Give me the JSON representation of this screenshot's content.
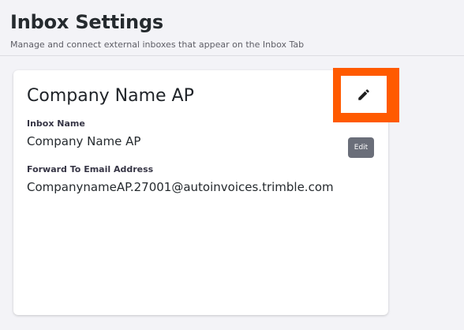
{
  "header": {
    "title": "Inbox Settings",
    "subtitle": "Manage and connect external inboxes that appear on the Inbox Tab"
  },
  "card": {
    "title": "Company Name AP",
    "inbox_name_label": "Inbox Name",
    "inbox_name_value": "Company Name AP",
    "forward_label": "Forward To Email Address",
    "forward_value": "CompanynameAP.27001@autoinvoices.trimble.com",
    "edit_label": "Edit"
  },
  "icons": {
    "highlighted": "pencil-icon"
  },
  "colors": {
    "highlight": "#ff5a00",
    "edit_button": "#6a6e79"
  }
}
